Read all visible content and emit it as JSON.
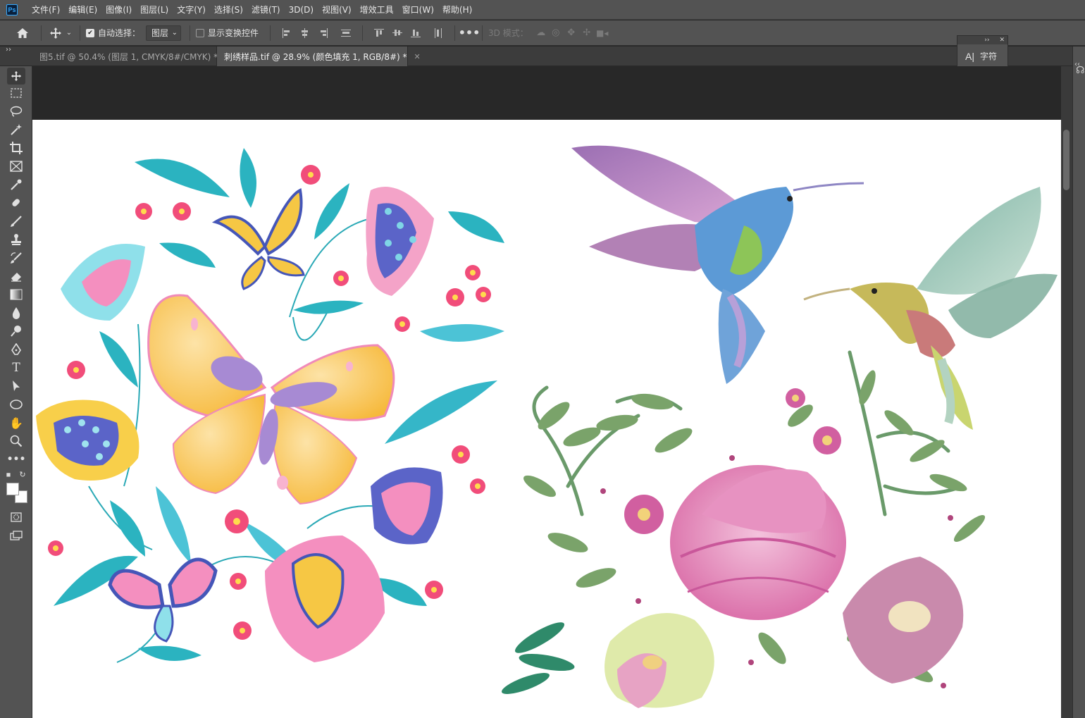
{
  "menu": {
    "logo": "Ps",
    "items": [
      "文件(F)",
      "编辑(E)",
      "图像(I)",
      "图层(L)",
      "文字(Y)",
      "选择(S)",
      "滤镜(T)",
      "3D(D)",
      "视图(V)",
      "增效工具",
      "窗口(W)",
      "帮助(H)"
    ]
  },
  "options": {
    "auto_select_label": "自动选择：",
    "auto_select_checked": true,
    "auto_select_target": "图层",
    "show_transform_label": "显示变换控件",
    "show_transform_checked": false,
    "mode_3d_label": "3D 模式："
  },
  "tabs": [
    {
      "title": "图5.tif @ 50.4% (图层 1, CMYK/8#/CMYK) *",
      "active": false
    },
    {
      "title": "刺绣样品.tif @ 28.9% (颜色填充 1, RGB/8#) *",
      "active": true
    }
  ],
  "panel": {
    "character_label": "字符",
    "character_icon": "A|"
  },
  "icons": {
    "home": "home-icon",
    "move": "move-tool-icon",
    "more": "more-options-icon"
  },
  "colors": {
    "chrome": "#535353",
    "pasteboard": "#282828",
    "accent": "#31a8ff"
  }
}
